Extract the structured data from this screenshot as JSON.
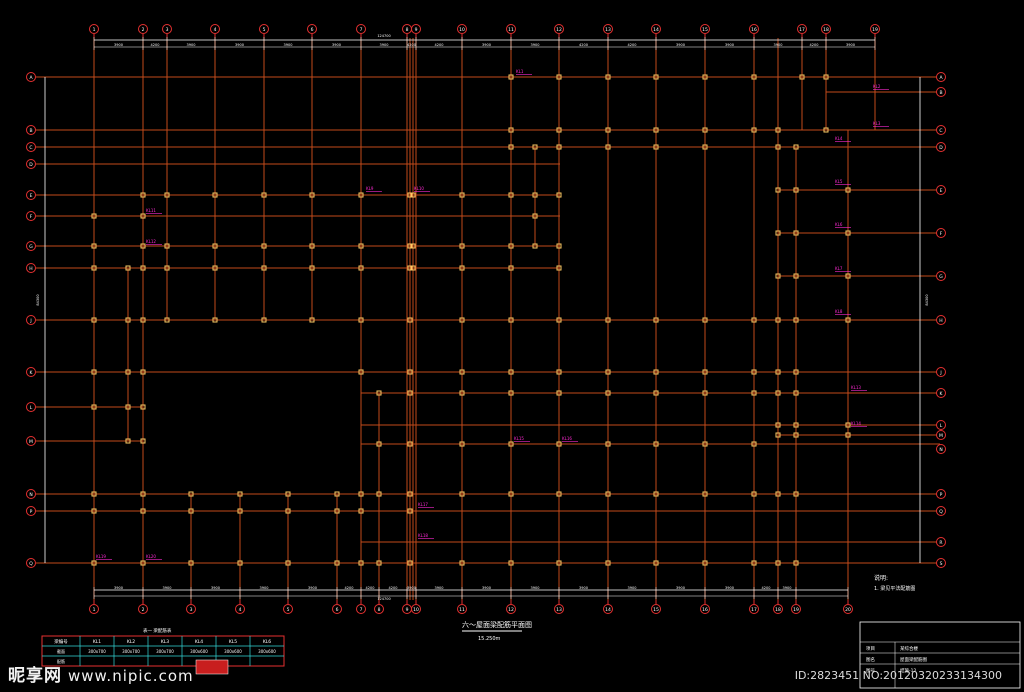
{
  "drawing": {
    "title": "六～屋面梁配筋平面图",
    "subtitle": "15.250m",
    "note_heading": "说明:",
    "note_text": "1. 梁见平法配筋图",
    "top_overall_dim": "124700",
    "bottom_overall_dim": "124700",
    "left_overall_dim": "84300",
    "right_overall_dim": "84300",
    "x_axes_top": [
      [
        "1",
        "94"
      ],
      [
        "2",
        "143"
      ],
      [
        "3",
        "167"
      ],
      [
        "4",
        "215"
      ],
      [
        "5",
        "264"
      ],
      [
        "6",
        "312"
      ],
      [
        "7",
        "361"
      ],
      [
        "8",
        "407"
      ],
      [
        "9",
        "416"
      ],
      [
        "10",
        "462"
      ],
      [
        "11",
        "511"
      ],
      [
        "12",
        "559"
      ],
      [
        "13",
        "608"
      ],
      [
        "14",
        "656"
      ],
      [
        "15",
        "705"
      ],
      [
        "16",
        "754"
      ],
      [
        "17",
        "802"
      ],
      [
        "18",
        "826"
      ],
      [
        "19",
        "875"
      ]
    ],
    "x_axes_bottom": [
      [
        "1",
        "94"
      ],
      [
        "2",
        "143"
      ],
      [
        "3",
        "191"
      ],
      [
        "4",
        "240"
      ],
      [
        "5",
        "288"
      ],
      [
        "6",
        "337"
      ],
      [
        "7",
        "361"
      ],
      [
        "8",
        "379"
      ],
      [
        "9",
        "407"
      ],
      [
        "10",
        "416"
      ],
      [
        "11",
        "462"
      ],
      [
        "12",
        "511"
      ],
      [
        "13",
        "559"
      ],
      [
        "14",
        "608"
      ],
      [
        "15",
        "656"
      ],
      [
        "16",
        "705"
      ],
      [
        "17",
        "754"
      ],
      [
        "18",
        "778"
      ],
      [
        "19",
        "796"
      ],
      [
        "20",
        "848"
      ]
    ],
    "y_axes_left": [
      [
        "A",
        "77"
      ],
      [
        "B",
        "130"
      ],
      [
        "C",
        "147"
      ],
      [
        "D",
        "164"
      ],
      [
        "E",
        "195"
      ],
      [
        "F",
        "216"
      ],
      [
        "G",
        "246"
      ],
      [
        "H",
        "268"
      ],
      [
        "J",
        "320"
      ],
      [
        "K",
        "372"
      ],
      [
        "L",
        "407"
      ],
      [
        "M",
        "441"
      ],
      [
        "N",
        "494"
      ],
      [
        "P",
        "511"
      ],
      [
        "Q",
        "563"
      ]
    ],
    "y_axes_right": [
      [
        "A",
        "77"
      ],
      [
        "B",
        "92"
      ],
      [
        "C",
        "130"
      ],
      [
        "D",
        "147"
      ],
      [
        "E",
        "190"
      ],
      [
        "F",
        "233"
      ],
      [
        "G",
        "276"
      ],
      [
        "H",
        "320"
      ],
      [
        "J",
        "372"
      ],
      [
        "K",
        "393"
      ],
      [
        "L",
        "425"
      ],
      [
        "M",
        "435"
      ],
      [
        "N",
        "449"
      ],
      [
        "P",
        "494"
      ],
      [
        "Q",
        "511"
      ],
      [
        "R",
        "542"
      ],
      [
        "S",
        "563"
      ]
    ],
    "dims_top": [
      "3900",
      "4200",
      "3900",
      "3900",
      "3900",
      "3900",
      "3900",
      "4200",
      "4200",
      "3900",
      "3900",
      "4200",
      "4200",
      "3900",
      "3900",
      "3900",
      "4200",
      "3900"
    ],
    "dims_bottom": [
      "3900",
      "3900",
      "3900",
      "3900",
      "3900",
      "4200",
      "4200",
      "4200",
      "3900",
      "3900",
      "3900",
      "3900",
      "3900",
      "3900",
      "3900",
      "3900",
      "4200",
      "3900"
    ],
    "beam_tags": [
      [
        "KL1",
        "520",
        "73"
      ],
      [
        "KL2",
        "877",
        "88"
      ],
      [
        "KL3",
        "877",
        "125"
      ],
      [
        "KL4",
        "839",
        "140"
      ],
      [
        "KL5",
        "839",
        "183"
      ],
      [
        "KL6",
        "839",
        "226"
      ],
      [
        "KL7",
        "839",
        "270"
      ],
      [
        "KL8",
        "839",
        "313"
      ],
      [
        "KL9",
        "370",
        "190"
      ],
      [
        "KL10",
        "418",
        "190"
      ],
      [
        "KL11",
        "150",
        "212"
      ],
      [
        "KL12",
        "150",
        "243"
      ],
      [
        "KL13",
        "855",
        "389"
      ],
      [
        "KL14",
        "855",
        "425"
      ],
      [
        "KL15",
        "518",
        "440"
      ],
      [
        "KL16",
        "566",
        "440"
      ],
      [
        "KL17",
        "422",
        "506"
      ],
      [
        "KL18",
        "422",
        "537"
      ],
      [
        "KL19",
        "100",
        "558"
      ],
      [
        "KL20",
        "150",
        "558"
      ]
    ],
    "table": {
      "headers": [
        "梁编号",
        "KL1",
        "KL2",
        "KL3",
        "KL4",
        "KL5",
        "KL6"
      ],
      "rows": [
        [
          "截面",
          "300x700",
          "300x700",
          "300x700",
          "300x600",
          "300x600",
          "300x600"
        ],
        [
          "配筋",
          "",
          "",
          "",
          "",
          "",
          ""
        ]
      ],
      "title": "表一  梁配筋表"
    },
    "title_block": {
      "rows": [
        [
          "项目",
          "某综合楼"
        ],
        [
          "图名",
          "屋面梁配筋图"
        ],
        [
          "图号",
          "结施-12"
        ]
      ]
    },
    "colors": {
      "grid": "#c24a1a",
      "axis": "#e63030",
      "column": "#ffcc66",
      "tag": "#ff2ad4",
      "dim": "#ffffff",
      "table": "#e63030",
      "table_grid": "#33d9d9"
    }
  },
  "watermark": {
    "brand": "昵享网",
    "site": "www.nipic.com",
    "id_text": "ID:2823451 NO:20120320233134300"
  }
}
